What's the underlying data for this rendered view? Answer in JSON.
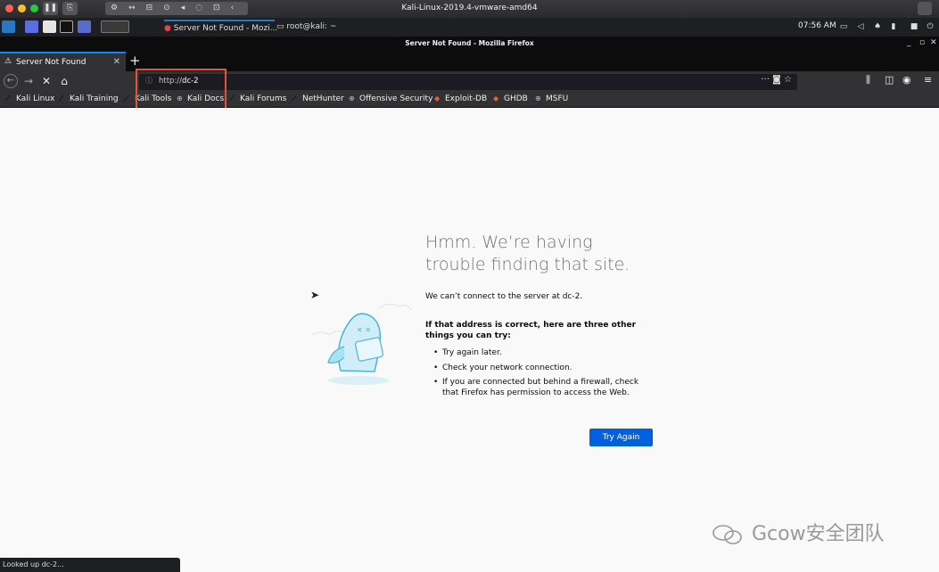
{
  "vm": {
    "title": "Kali-Linux-2019.4-vmware-amd64",
    "traffic_colors": [
      "#fe5f57",
      "#febc2e",
      "#28c840"
    ]
  },
  "taskbar": {
    "tasks": [
      {
        "label": "Server Not Found - Mozi..."
      },
      {
        "label": "root@kali: ~"
      }
    ],
    "clock": "07:56 AM"
  },
  "firefox": {
    "window_title": "Server Not Found - Mozilla Firefox",
    "tab_label": "Server Not Found",
    "new_tab": "+",
    "url_scheme": "http://",
    "url_host": "dc-2",
    "highlight_color": "#e4533b"
  },
  "bookmarks": [
    {
      "label": "Kali Linux",
      "icon": "kali-dragon-icon"
    },
    {
      "label": "Kali Training",
      "icon": "kali-dragon-icon"
    },
    {
      "label": "Kali Tools",
      "icon": "kali-dragon-icon"
    },
    {
      "label": "Kali Docs",
      "icon": "globe-icon"
    },
    {
      "label": "Kali Forums",
      "icon": "kali-dragon-icon"
    },
    {
      "label": "NetHunter",
      "icon": "kali-dragon-icon"
    },
    {
      "label": "Offensive Security",
      "icon": "globe-icon"
    },
    {
      "label": "Exploit-DB",
      "icon": "exploitdb-icon"
    },
    {
      "label": "GHDB",
      "icon": "exploitdb-icon"
    },
    {
      "label": "MSFU",
      "icon": "globe-icon"
    }
  ],
  "error": {
    "title": "Hmm. We’re having trouble finding that site.",
    "description": "We can’t connect to the server at dc-2.",
    "subtitle": "If that address is correct, here are three other things you can try:",
    "items": [
      "Try again later.",
      "Check your network connection.",
      "If you are connected but behind a firewall, check that Firefox has permission to access the Web."
    ],
    "button": "Try Again",
    "button_color": "#0060df"
  },
  "watermark": "Gcow安全团队",
  "status": "Looked up dc-2..."
}
